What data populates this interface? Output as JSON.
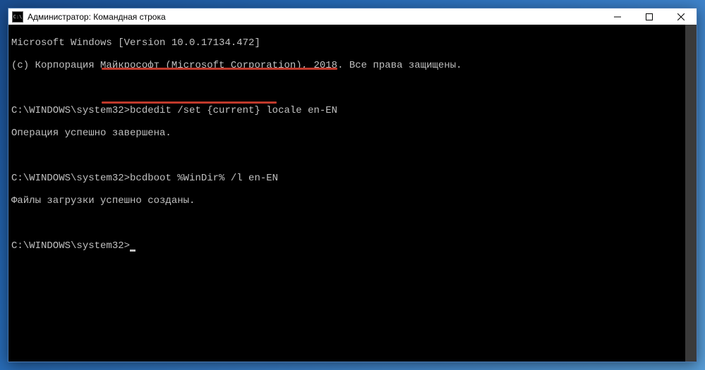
{
  "titlebar": {
    "app_icon_text": "C:\\",
    "title": "Администратор: Командная строка"
  },
  "terminal": {
    "line1": "Microsoft Windows [Version 10.0.17134.472]",
    "line2": "(c) Корпорация Майкрософт (Microsoft Corporation), 2018. Все права защищены.",
    "line3": "",
    "prompt1": "C:\\WINDOWS\\system32>",
    "cmd1": "bcdedit /set {current} locale en-EN",
    "resp1": "Операция успешно завершена.",
    "line_blank2": "",
    "prompt2": "C:\\WINDOWS\\system32>",
    "cmd2": "bcdboot %WinDir% /l en-EN",
    "resp2": "Файлы загрузки успешно созданы.",
    "line_blank3": "",
    "prompt3": "C:\\WINDOWS\\system32>"
  }
}
